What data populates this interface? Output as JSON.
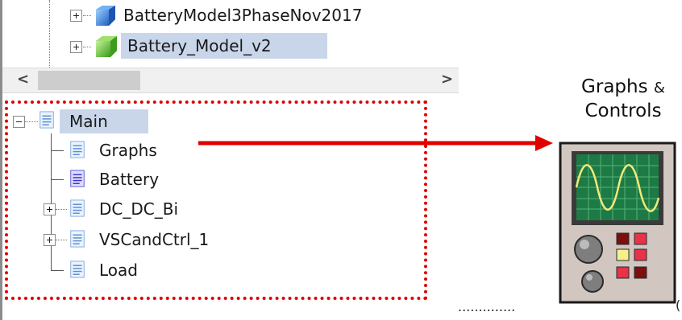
{
  "top_tree": {
    "items": [
      {
        "label": "BatteryModel3PhaseNov2017",
        "icon": "blue-cube-icon"
      },
      {
        "label": "Battery_Model_v2",
        "icon": "green-cube-icon",
        "selected": true
      }
    ]
  },
  "scrollbar": {
    "left_arrow": "<",
    "right_arrow": ">"
  },
  "bottom_tree": {
    "root": {
      "label": "Main",
      "expanded": true
    },
    "children": [
      {
        "label": "Graphs",
        "expandable": false
      },
      {
        "label": "Battery",
        "expandable": false
      },
      {
        "label": "DC_DC_Bi",
        "expandable": true
      },
      {
        "label": "VSCandCtrl_1",
        "expandable": true
      },
      {
        "label": "Load",
        "expandable": false
      }
    ]
  },
  "callout": {
    "title_line1": "Graphs",
    "title_amp": "&",
    "title_line2": "Controls",
    "icon": "oscilloscope-icon",
    "dots": "..............",
    "edge_char": "("
  },
  "colors": {
    "selection": "#c9d6ea",
    "dotted_border": "#e00000",
    "arrow": "#e00000",
    "oscilloscope_body": "#d2c6c0",
    "oscilloscope_screen": "#1d7a45",
    "waveform": "#f2ea7a"
  }
}
